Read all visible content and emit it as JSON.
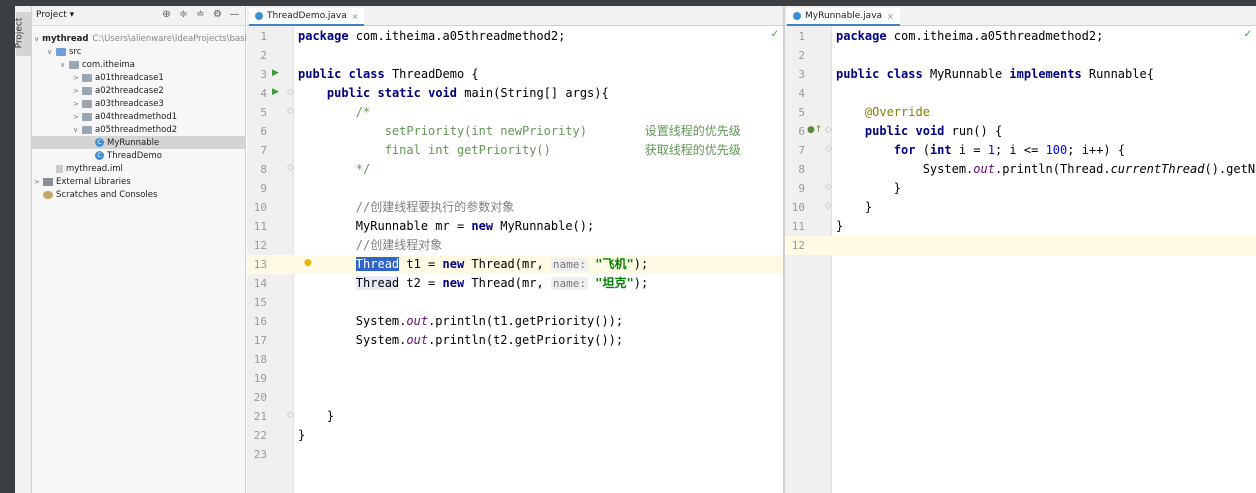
{
  "project_panel": {
    "title": "Project ▾",
    "side_tab": "Project",
    "header_icons": [
      "⊕",
      "≑",
      "≐",
      "⚙",
      "—"
    ],
    "tree": [
      {
        "label": "mythread",
        "extra": "C:\\Users\\alienware\\IdeaProjects\\basic-",
        "indent": 0,
        "arrow": "∨",
        "icon": "folder-gray",
        "bold": true
      },
      {
        "label": "src",
        "indent": 1,
        "arrow": "∨",
        "icon": "folder-blue"
      },
      {
        "label": "com.itheima",
        "indent": 2,
        "arrow": "∨",
        "icon": "folder-gray"
      },
      {
        "label": "a01threadcase1",
        "indent": 3,
        "arrow": ">",
        "icon": "folder-gray"
      },
      {
        "label": "a02threadcase2",
        "indent": 3,
        "arrow": ">",
        "icon": "folder-gray"
      },
      {
        "label": "a03threadcase3",
        "indent": 3,
        "arrow": ">",
        "icon": "folder-gray"
      },
      {
        "label": "a04threadmethod1",
        "indent": 3,
        "arrow": ">",
        "icon": "folder-gray"
      },
      {
        "label": "a05threadmethod2",
        "indent": 3,
        "arrow": "∨",
        "icon": "folder-gray"
      },
      {
        "label": "MyRunnable",
        "indent": 4,
        "arrow": "",
        "icon": "class",
        "selected": true
      },
      {
        "label": "ThreadDemo",
        "indent": 4,
        "arrow": "",
        "icon": "class"
      },
      {
        "label": "mythread.iml",
        "indent": 1,
        "arrow": "",
        "icon": "file"
      },
      {
        "label": "External Libraries",
        "indent": 0,
        "arrow": ">",
        "icon": "lib"
      },
      {
        "label": "Scratches and Consoles",
        "indent": 0,
        "arrow": "",
        "icon": "scratch"
      }
    ]
  },
  "left_editor": {
    "tab": "ThreadDemo.java",
    "lines": [
      {
        "n": "1",
        "code": "package com.itheima.a05threadmethod2;"
      },
      {
        "n": "2",
        "code": ""
      },
      {
        "n": "3",
        "code": "public class ThreadDemo {"
      },
      {
        "n": "4",
        "code": "    public static void main(String[] args){"
      },
      {
        "n": "5",
        "code": "        /*"
      },
      {
        "n": "6",
        "code": "            setPriority(int newPriority)        设置线程的优先级"
      },
      {
        "n": "7",
        "code": "            final int getPriority()             获取线程的优先级"
      },
      {
        "n": "8",
        "code": "        */"
      },
      {
        "n": "9",
        "code": ""
      },
      {
        "n": "10",
        "code": "        //创建线程要执行的参数对象"
      },
      {
        "n": "11",
        "code": "        MyRunnable mr = new MyRunnable();"
      },
      {
        "n": "12",
        "code": "        //创建线程对象"
      },
      {
        "n": "13",
        "code": "        Thread t1 = new Thread(mr, name: \"飞机\");"
      },
      {
        "n": "14",
        "code": "        Thread t2 = new Thread(mr, name: \"坦克\");"
      },
      {
        "n": "15",
        "code": ""
      },
      {
        "n": "16",
        "code": "        System.out.println(t1.getPriority());"
      },
      {
        "n": "17",
        "code": "        System.out.println(t2.getPriority());"
      },
      {
        "n": "18",
        "code": ""
      },
      {
        "n": "19",
        "code": ""
      },
      {
        "n": "20",
        "code": ""
      },
      {
        "n": "21",
        "code": "    }"
      },
      {
        "n": "22",
        "code": "}"
      },
      {
        "n": "23",
        "code": ""
      }
    ]
  },
  "right_editor": {
    "tab": "MyRunnable.java",
    "lines": [
      {
        "n": "1",
        "code": "package com.itheima.a05threadmethod2;"
      },
      {
        "n": "2",
        "code": ""
      },
      {
        "n": "3",
        "code": "public class MyRunnable implements Runnable{"
      },
      {
        "n": "4",
        "code": ""
      },
      {
        "n": "5",
        "code": "    @Override"
      },
      {
        "n": "6",
        "code": "    public void run() {"
      },
      {
        "n": "7",
        "code": "        for (int i = 1; i <= 100; i++) {"
      },
      {
        "n": "8",
        "code": "            System.out.println(Thread.currentThread().getNa"
      },
      {
        "n": "9",
        "code": "        }"
      },
      {
        "n": "10",
        "code": "    }"
      },
      {
        "n": "11",
        "code": "}"
      },
      {
        "n": "12",
        "code": ""
      }
    ]
  },
  "colors": {
    "keyword": "#000080",
    "comment": "#808080",
    "doc": "#629755",
    "string": "#008000",
    "number": "#0000ff",
    "annotation": "#808000",
    "selection": "#2f65ca"
  }
}
